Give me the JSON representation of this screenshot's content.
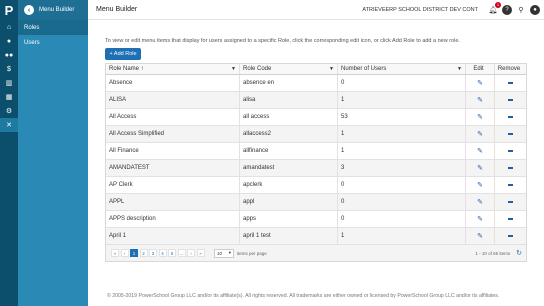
{
  "app": {
    "section_title": "Menu Builder",
    "page_title": "Menu Builder",
    "district": "ATRIEVEERP SCHOOL DISTRICT DEV CONT",
    "notification_count": "1"
  },
  "nav": {
    "logo": "P",
    "rail_icons": [
      "home-icon",
      "user-icon",
      "users-icon",
      "dollar-icon",
      "bar-chart-icon",
      "calendar-icon",
      "gear-icon",
      "tools-icon"
    ],
    "items": [
      {
        "label": "Roles"
      },
      {
        "label": "Users"
      }
    ]
  },
  "main": {
    "description": "To view or edit menu items that display for users assigned to a specific Role, click the corresponding edit icon, or click Add Role to add a new role.",
    "add_button": "+ Add Role"
  },
  "table": {
    "headers": {
      "role_name": "Role Name",
      "sort_indicator": "↑",
      "role_code": "Role Code",
      "users": "Number of Users",
      "edit": "Edit",
      "remove": "Remove"
    },
    "rows": [
      {
        "name": "Absence",
        "code": "absence en",
        "users": "0"
      },
      {
        "name": "ALISA",
        "code": "alisa",
        "users": "1"
      },
      {
        "name": "All Access",
        "code": "all access",
        "users": "53"
      },
      {
        "name": "All Access Simplified",
        "code": "allaccess2",
        "users": "1"
      },
      {
        "name": "All Finance",
        "code": "allfinance",
        "users": "1"
      },
      {
        "name": "AMANDATEST",
        "code": "amandatest",
        "users": "3"
      },
      {
        "name": "AP Clerk",
        "code": "apclerk",
        "users": "0"
      },
      {
        "name": "APPL",
        "code": "appl",
        "users": "0"
      },
      {
        "name": "APPS description",
        "code": "apps",
        "users": "0"
      },
      {
        "name": "April 1",
        "code": "april 1 test",
        "users": "1"
      }
    ]
  },
  "pager": {
    "first": "«",
    "prev": "‹",
    "pages": [
      "1",
      "2",
      "3",
      "4",
      "5",
      "..."
    ],
    "next": "›",
    "last": "»",
    "per_page_value": "10",
    "per_page_label": "items per page",
    "summary": "1 - 10 of 65 items"
  },
  "footer": "© 2005-2019 PowerSchool Group LLC and/or its affiliate(s). All rights reserved. All trademarks are either owned or licensed by PowerSchool Group LLC and/or its affiliates."
}
